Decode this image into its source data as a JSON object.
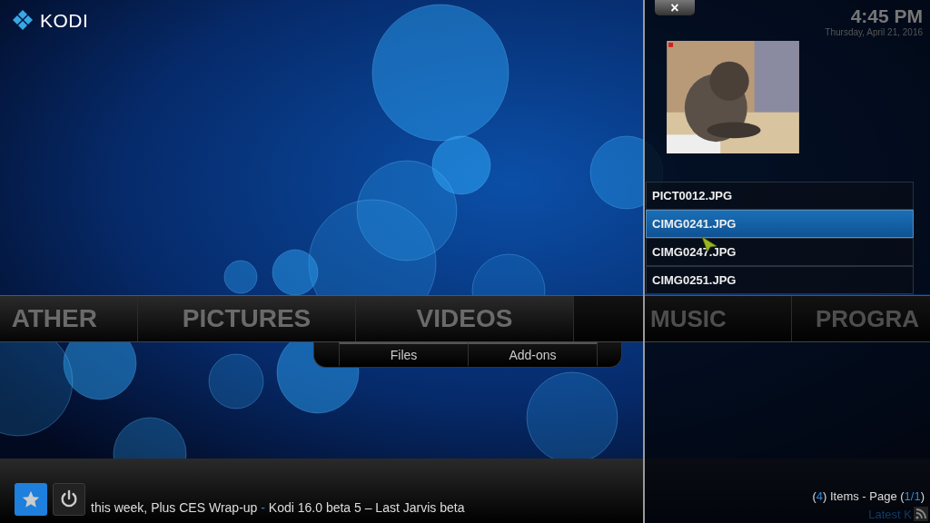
{
  "logo": {
    "text": "KODI"
  },
  "menu": [
    {
      "label": "ATHER",
      "kind": "cut-left",
      "dimmed": false
    },
    {
      "label": "PICTURES",
      "kind": "full",
      "dimmed": false
    },
    {
      "label": "VIDEOS",
      "kind": "full",
      "dimmed": false
    },
    {
      "label": "MUSIC",
      "kind": "behind",
      "dimmed": true
    },
    {
      "label": "PROGRA",
      "kind": "cut-right",
      "dimmed": true
    }
  ],
  "submenu": [
    "Files",
    "Add-ons"
  ],
  "ticker": [
    {
      "text": "this week, Plus CES Wrap-up ",
      "kind": "plain"
    },
    {
      "text": "-",
      "kind": "accent"
    },
    {
      "text": " Kodi 16.0 beta 5 – Last Jarvis beta",
      "kind": "plain"
    }
  ],
  "panel": {
    "close": "×",
    "time": "4:45 PM",
    "date": "Thursday, April 21, 2016",
    "files": [
      {
        "name": "PICT0012.JPG",
        "selected": false
      },
      {
        "name": "CIMG0241.JPG",
        "selected": true
      },
      {
        "name": "CIMG0247.JPG",
        "selected": false
      },
      {
        "name": "CIMG0251.JPG",
        "selected": false
      }
    ],
    "footer": [
      {
        "text": "(",
        "kind": "plain"
      },
      {
        "text": "4",
        "kind": "accent"
      },
      {
        "text": ") Items - Page (",
        "kind": "plain"
      },
      {
        "text": "1/1",
        "kind": "accent"
      },
      {
        "text": ")",
        "kind": "plain"
      }
    ],
    "rss_label": "Latest K"
  }
}
